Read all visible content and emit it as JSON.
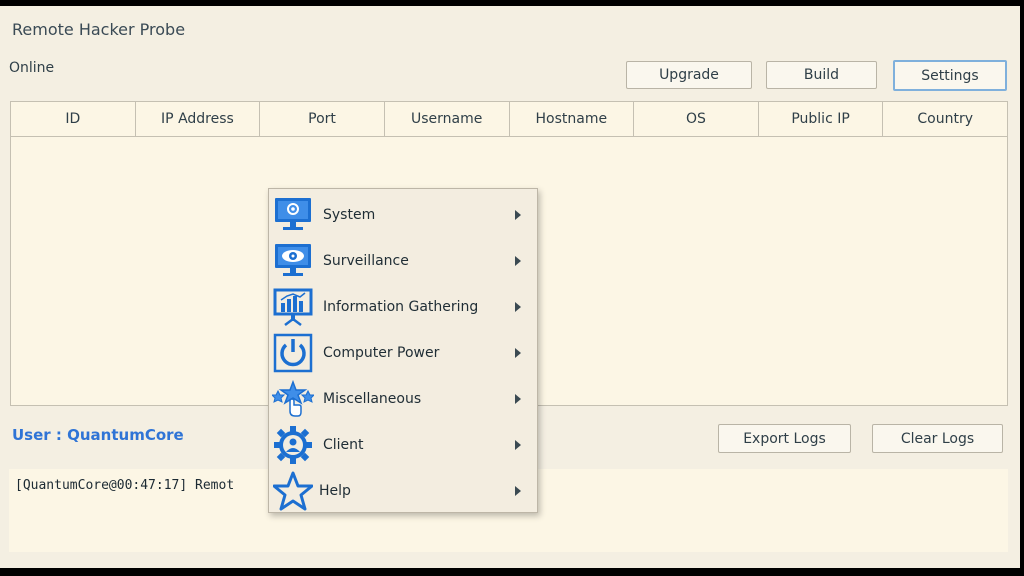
{
  "app": {
    "title": "Remote Hacker Probe",
    "status": "Online"
  },
  "toolbar": {
    "upgrade": "Upgrade",
    "build": "Build",
    "settings": "Settings"
  },
  "grid": {
    "columns": [
      "ID",
      "IP Address",
      "Port",
      "Username",
      "Hostname",
      "OS",
      "Public IP",
      "Country"
    ]
  },
  "user": {
    "label": "User : QuantumCore"
  },
  "logs": {
    "export": "Export Logs",
    "clear": "Clear Logs",
    "line": "[QuantumCore@00:47:17] Remot"
  },
  "context_menu": {
    "items": [
      {
        "label": "System",
        "icon": "monitor-gear-icon"
      },
      {
        "label": "Surveillance",
        "icon": "monitor-eye-icon"
      },
      {
        "label": "Information Gathering",
        "icon": "monitor-chart-icon"
      },
      {
        "label": "Computer Power",
        "icon": "power-icon"
      },
      {
        "label": "Miscellaneous",
        "icon": "stars-hand-icon"
      },
      {
        "label": "Client",
        "icon": "gear-person-icon"
      },
      {
        "label": "Help",
        "icon": "star-icon"
      }
    ]
  },
  "colors": {
    "accent": "#2f74d6",
    "icon_blue": "#1c6fd1",
    "background": "#f4efe2"
  }
}
